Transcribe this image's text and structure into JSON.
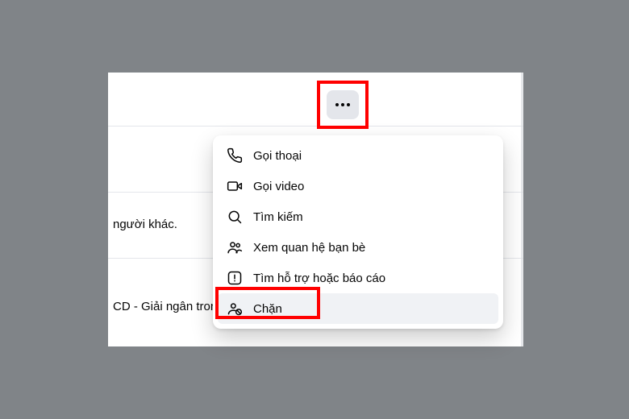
{
  "background_text": {
    "frag1": "người khác.",
    "frag2": "CD - Giải ngân tron"
  },
  "more_button": {
    "label": "More options"
  },
  "menu": {
    "items": [
      {
        "icon": "phone",
        "label": "Gọi thoại"
      },
      {
        "icon": "video",
        "label": "Gọi video"
      },
      {
        "icon": "search",
        "label": "Tìm kiếm"
      },
      {
        "icon": "friends",
        "label": "Xem quan hệ bạn bè"
      },
      {
        "icon": "report",
        "label": "Tìm hỗ trợ hoặc báo cáo"
      },
      {
        "icon": "block",
        "label": "Chặn"
      }
    ]
  },
  "highlighted_items": [
    "more-button",
    "menu-item-block"
  ],
  "colors": {
    "highlight": "#ff0000",
    "panel_bg": "#ffffff",
    "body_bg": "#808488",
    "btn_bg": "#e4e6eb"
  }
}
